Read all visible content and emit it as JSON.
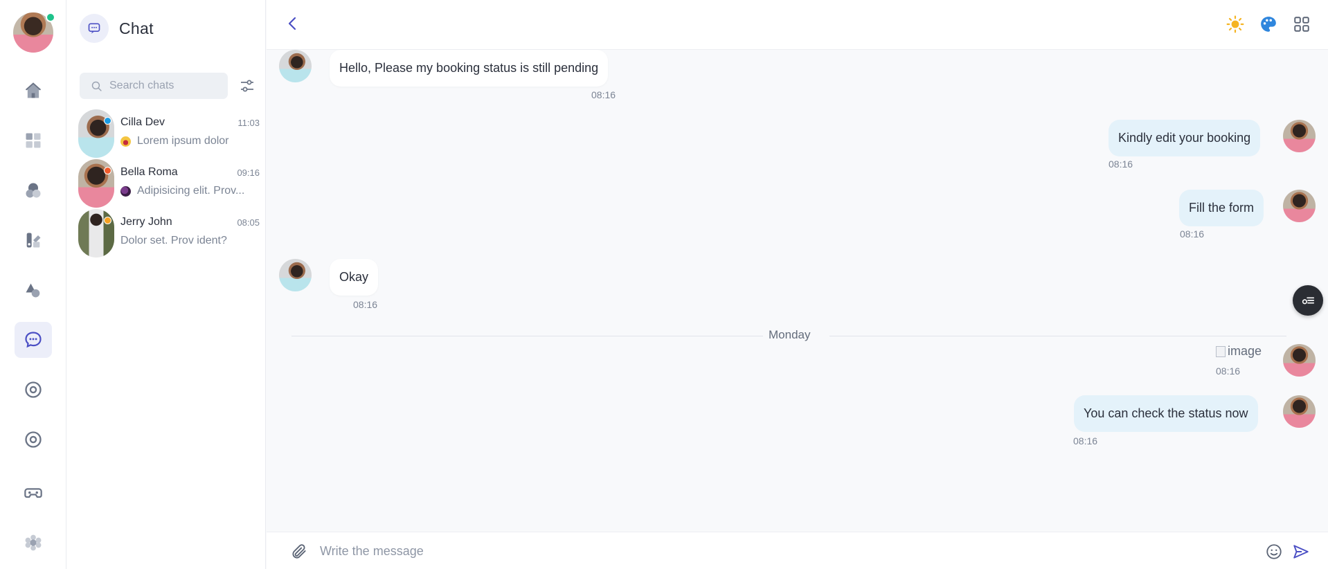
{
  "sidebar": {
    "user_status": "online",
    "items": [
      {
        "name": "home-icon"
      },
      {
        "name": "dashboard-icon"
      },
      {
        "name": "shapes-icon"
      },
      {
        "name": "apps-icon"
      },
      {
        "name": "triangle-circle-icon"
      },
      {
        "name": "chat-icon",
        "active": true
      },
      {
        "name": "target-icon"
      },
      {
        "name": "target-icon"
      },
      {
        "name": "gamepad-icon"
      },
      {
        "name": "settings-icon"
      }
    ]
  },
  "chat_panel": {
    "title": "Chat",
    "search_placeholder": "Search chats",
    "chats": [
      {
        "name": "Cilla Dev",
        "time": "11:03",
        "preview": "Lorem ipsum dolor",
        "status_color": "#1a9be3",
        "emoji_color": "#ef8aa0"
      },
      {
        "name": "Bella Roma",
        "time": "09:16",
        "preview": "Adipisicing elit. Prov...",
        "status_color": "#ef5a2b",
        "emoji_color": "#4b2a5a"
      },
      {
        "name": "Jerry John",
        "time": "08:05",
        "preview": "Dolor set. Prov ident?",
        "status_color": "#f5a122"
      }
    ]
  },
  "conversation": {
    "messages": [
      {
        "direction": "in",
        "text": "Hello, Please my booking status is still pending",
        "time": "08:16"
      },
      {
        "direction": "out",
        "text": "Kindly edit your booking",
        "time": "08:16"
      },
      {
        "direction": "out",
        "text": "Fill the form",
        "time": "08:16"
      },
      {
        "direction": "in",
        "text": "Okay",
        "time": "08:16"
      },
      {
        "direction": "out",
        "image_alt": "image",
        "time": "08:16"
      },
      {
        "direction": "out",
        "text": "You can check the status now",
        "time": "08:16"
      }
    ],
    "day_divider": "Monday"
  },
  "composer": {
    "placeholder": "Write the message"
  },
  "colors": {
    "accent": "#4b4fc4",
    "incoming_bubble": "#ffffff",
    "outgoing_bubble": "#e4f2fa",
    "online": "#1ec28b"
  }
}
